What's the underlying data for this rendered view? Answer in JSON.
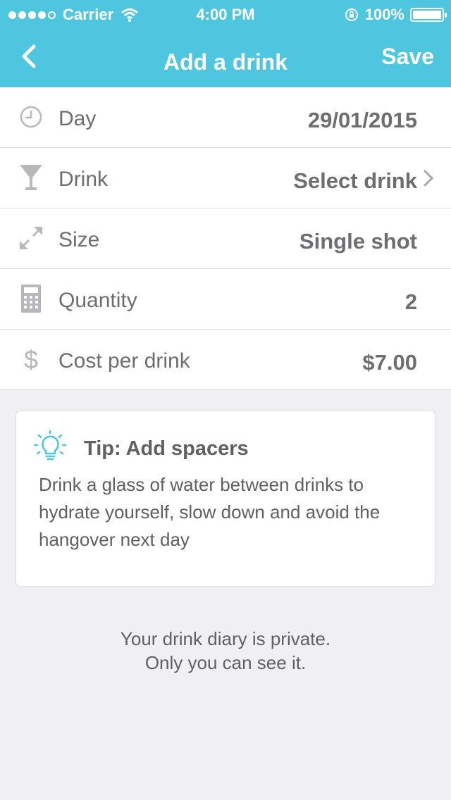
{
  "status_bar": {
    "carrier": "Carrier",
    "time": "4:00 PM",
    "battery": "100%"
  },
  "nav": {
    "title": "Add a drink",
    "save_label": "Save"
  },
  "rows": [
    {
      "label": "Day",
      "value": "29/01/2015",
      "icon": "clock-icon"
    },
    {
      "label": "Drink",
      "value": "Select drink",
      "icon": "cocktail-glass-icon"
    },
    {
      "label": "Size",
      "value": "Single shot",
      "icon": "resize-arrows-icon"
    },
    {
      "label": "Quantity",
      "value": "2",
      "icon": "calculator-icon"
    },
    {
      "label": "Cost per drink",
      "value": "$7.00",
      "icon": "dollar-icon"
    }
  ],
  "tip": {
    "title": "Tip: Add spacers",
    "body": "Drink a glass of water between drinks to hydrate yourself, slow down and avoid the hangover next day",
    "icon": "lightbulb-icon"
  },
  "privacy": {
    "line1": "Your drink diary is private.",
    "line2": "Only you can see it."
  },
  "colors": {
    "header": "#4ec6e0",
    "background": "#efeff4",
    "text": "#6d6d72"
  }
}
